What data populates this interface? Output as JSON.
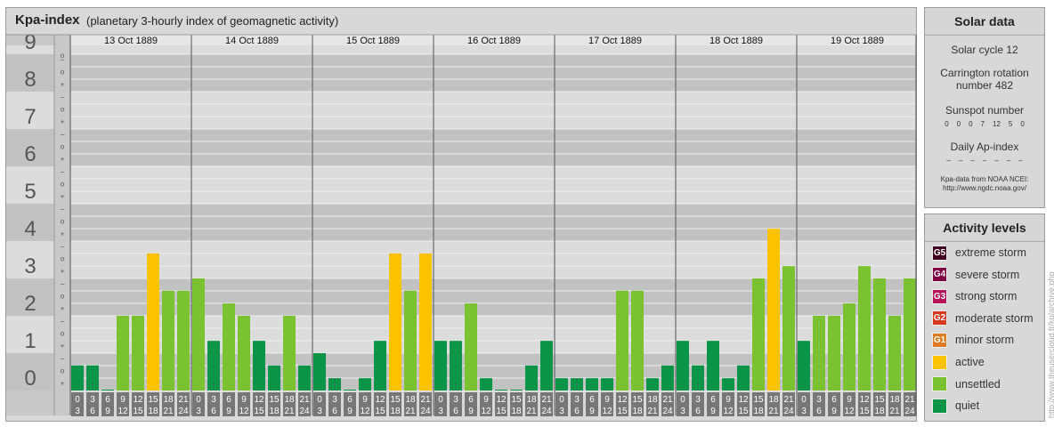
{
  "header": {
    "title": "Kpa-index",
    "subtitle": "(planetary 3-hourly index of geomagnetic activity)"
  },
  "chart_data": {
    "type": "bar",
    "title": "Kpa-index",
    "subtitle": "(planetary 3-hourly index of geomagnetic activity)",
    "ylim": [
      0,
      9
    ],
    "y_ticks": [
      "0",
      "1",
      "2",
      "3",
      "4",
      "5",
      "6",
      "7",
      "8",
      "9"
    ],
    "sub_ticks": [
      "+",
      "o",
      "–"
    ],
    "days": [
      "13 Oct 1889",
      "14 Oct 1889",
      "15 Oct 1889",
      "16 Oct 1889",
      "17 Oct 1889",
      "18 Oct 1889",
      "19 Oct 1889"
    ],
    "interval_labels": [
      [
        "0",
        "3"
      ],
      [
        "3",
        "6"
      ],
      [
        "6",
        "9"
      ],
      [
        "9",
        "12"
      ],
      [
        "12",
        "15"
      ],
      [
        "15",
        "18"
      ],
      [
        "18",
        "21"
      ],
      [
        "21",
        "24"
      ]
    ],
    "values": [
      [
        0.67,
        0.67,
        0,
        2,
        2,
        3.67,
        2.67,
        2.67
      ],
      [
        3,
        1.33,
        2.33,
        2,
        1.33,
        0.67,
        2,
        0.67
      ],
      [
        1,
        0.33,
        0,
        0.33,
        1.33,
        3.67,
        2.67,
        3.67
      ],
      [
        1.33,
        1.33,
        2.33,
        0.33,
        0,
        0,
        0.67,
        1.33
      ],
      [
        0.33,
        0.33,
        0.33,
        0.33,
        2.67,
        2.67,
        0.33,
        0.67
      ],
      [
        1.33,
        0.67,
        1.33,
        0.33,
        0.67,
        3,
        4.33,
        3.33
      ],
      [
        1.33,
        2,
        2,
        2.33,
        3.33,
        3,
        2,
        3
      ]
    ],
    "colors": {
      "quiet": "#0a9447",
      "unsettled": "#7ac230",
      "active": "#fbc200",
      "minor": "#e07a1e",
      "moderate": "#d8391f",
      "strong": "#b8135a",
      "severe": "#800040",
      "extreme": "#400020"
    }
  },
  "solar": {
    "title": "Solar data",
    "cycle": "Solar cycle 12",
    "carrington": "Carrington rotation number 482",
    "sunspot_title": "Sunspot number",
    "sunspot_values": [
      "0",
      "0",
      "0",
      "7",
      "12",
      "5",
      "0"
    ],
    "ap_title": "Daily Ap-index",
    "ap_values": [
      "–",
      "–",
      "–",
      "–",
      "–",
      "–",
      "–"
    ],
    "source_line1": "Kpa-data from NOAA NCEI:",
    "source_line2": "http://www.ngdc.noaa.gov/"
  },
  "activity": {
    "title": "Activity levels",
    "levels": [
      {
        "code": "G5",
        "label": "extreme storm",
        "color": "#400020"
      },
      {
        "code": "G4",
        "label": "severe storm",
        "color": "#800040"
      },
      {
        "code": "G3",
        "label": "strong storm",
        "color": "#b8135a"
      },
      {
        "code": "G2",
        "label": "moderate storm",
        "color": "#d8391f"
      },
      {
        "code": "G1",
        "label": "minor storm",
        "color": "#e07a1e"
      },
      {
        "code": "",
        "label": "active",
        "color": "#fbc200"
      },
      {
        "code": "",
        "label": "unsettled",
        "color": "#7ac230"
      },
      {
        "code": "",
        "label": "quiet",
        "color": "#0a9447"
      }
    ]
  },
  "watermark": "http://www.theusercloud.fr/kp/archive.php"
}
